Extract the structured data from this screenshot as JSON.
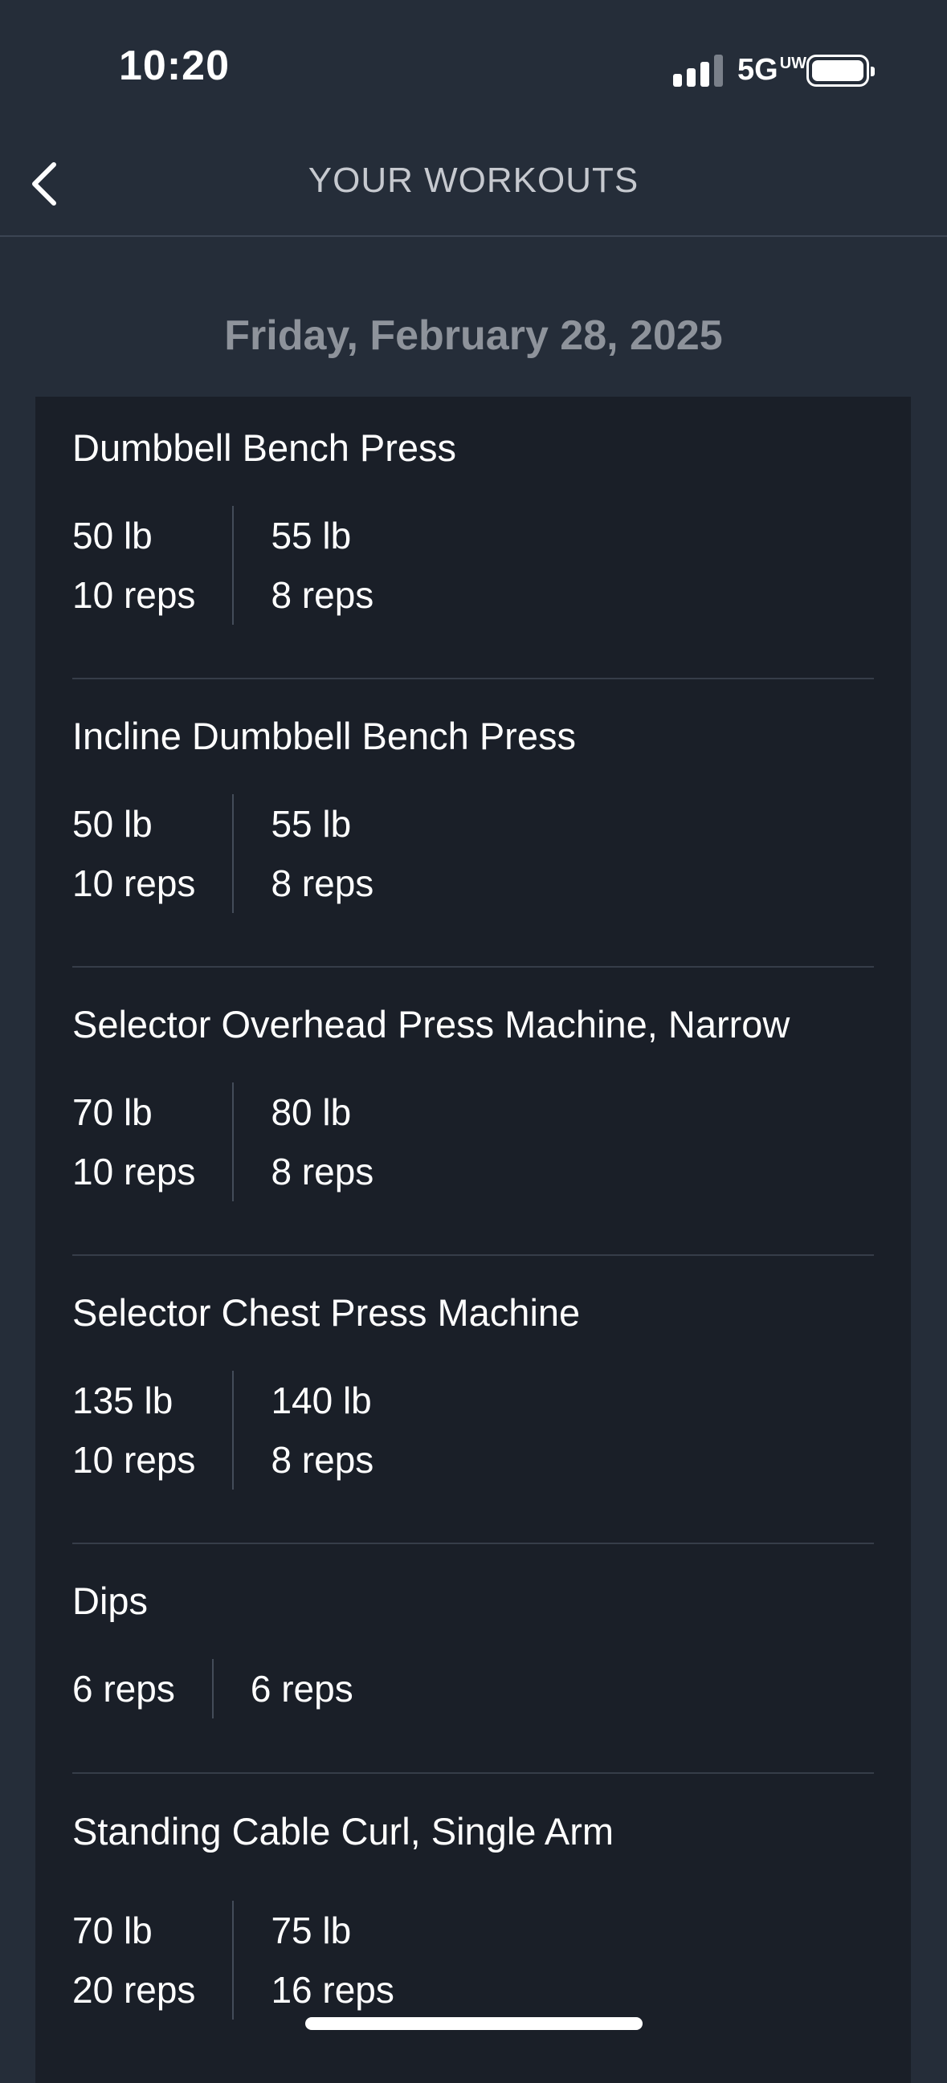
{
  "status_bar": {
    "time": "10:20",
    "network": "5G",
    "network_badge": "UW",
    "icons": [
      "signal-icon",
      "battery-icon"
    ]
  },
  "nav": {
    "title": "YOUR WORKOUTS",
    "back_icon": "chevron-left-icon"
  },
  "date": "Friday, February 28, 2025",
  "exercises": [
    {
      "name": "Dumbbell Bench Press",
      "sets": [
        {
          "weight": "50 lb",
          "reps": "10 reps"
        },
        {
          "weight": "55 lb",
          "reps": "8 reps"
        }
      ]
    },
    {
      "name": "Incline Dumbbell Bench Press",
      "sets": [
        {
          "weight": "50 lb",
          "reps": "10 reps"
        },
        {
          "weight": "55 lb",
          "reps": "8 reps"
        }
      ]
    },
    {
      "name": "Selector Overhead Press Machine, Narrow",
      "sets": [
        {
          "weight": "70 lb",
          "reps": "10 reps"
        },
        {
          "weight": "80 lb",
          "reps": "8 reps"
        }
      ]
    },
    {
      "name": "Selector Chest Press Machine",
      "sets": [
        {
          "weight": "135 lb",
          "reps": "10 reps"
        },
        {
          "weight": "140 lb",
          "reps": "8 reps"
        }
      ]
    },
    {
      "name": "Dips",
      "sets": [
        {
          "reps": "6 reps"
        },
        {
          "reps": "6 reps"
        }
      ]
    },
    {
      "name": "Standing Cable Curl, Single Arm",
      "sets": [
        {
          "weight": "70 lb",
          "reps": "20 reps"
        },
        {
          "weight": "75 lb",
          "reps": "16 reps"
        }
      ]
    }
  ],
  "colors": {
    "background": "#252d39",
    "card": "#1a1f28",
    "title_text": "#c6c9cf",
    "date_text": "#8e939b",
    "divider": "#363d49"
  }
}
